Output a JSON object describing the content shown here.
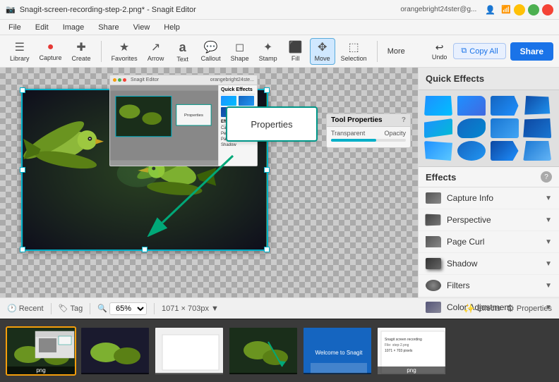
{
  "titleBar": {
    "title": "Snagit-screen-recording-step-2.png* - Snagit Editor",
    "userEmail": "orangebright24ster@g...",
    "minimizeLabel": "−",
    "maximizeLabel": "□",
    "closeLabel": "×"
  },
  "menuBar": {
    "items": [
      "File",
      "Edit",
      "Image",
      "Share",
      "View",
      "Help"
    ]
  },
  "toolbar": {
    "libraryLabel": "Library",
    "captureLabel": "Capture",
    "createLabel": "Create",
    "tools": [
      {
        "name": "Favorites",
        "icon": "★"
      },
      {
        "name": "Arrow",
        "icon": "↗"
      },
      {
        "name": "Text",
        "icon": "T"
      },
      {
        "name": "Callout",
        "icon": "💬"
      },
      {
        "name": "Shape",
        "icon": "◻"
      },
      {
        "name": "Stamp",
        "icon": "✦"
      },
      {
        "name": "Fill",
        "icon": "⬛"
      },
      {
        "name": "Move",
        "icon": "✥"
      },
      {
        "name": "Selection",
        "icon": "⬚"
      }
    ],
    "moreLabel": "More",
    "undoLabel": "Undo",
    "copyAllLabel": "Copy All",
    "shareLabel": "Share"
  },
  "quickEffects": {
    "title": "Quick Effects",
    "thumbnails": [
      "et1",
      "et2",
      "et3",
      "et4",
      "et5",
      "et6",
      "et7",
      "et8",
      "et9",
      "et10",
      "et11",
      "et12"
    ]
  },
  "effectsList": {
    "title": "Effects",
    "helpLabel": "?",
    "items": [
      {
        "name": "Capture Info",
        "iconClass": "ei-capture"
      },
      {
        "name": "Perspective",
        "iconClass": "ei-perspective"
      },
      {
        "name": "Page Curl",
        "iconClass": "ei-pagecurl"
      },
      {
        "name": "Shadow",
        "iconClass": "ei-shadow"
      },
      {
        "name": "Filters",
        "iconClass": "ei-filters"
      },
      {
        "name": "Color Adjustment",
        "iconClass": "ei-coloradj"
      }
    ]
  },
  "canvas": {
    "annotationLabel": "Properties",
    "toolPropsLabel": "Tool Properties"
  },
  "statusBar": {
    "recentLabel": "Recent",
    "tagLabel": "Tag",
    "zoomValue": "65%",
    "dimensions": "1071 × 703px",
    "effectsLabel": "Effects",
    "propertiesLabel": "Properties"
  },
  "thumbnails": [
    {
      "label": "png",
      "active": true
    },
    {
      "label": "",
      "active": false
    },
    {
      "label": "",
      "active": false
    },
    {
      "label": "",
      "active": false
    },
    {
      "label": "",
      "active": false
    },
    {
      "label": "png",
      "active": false
    }
  ]
}
